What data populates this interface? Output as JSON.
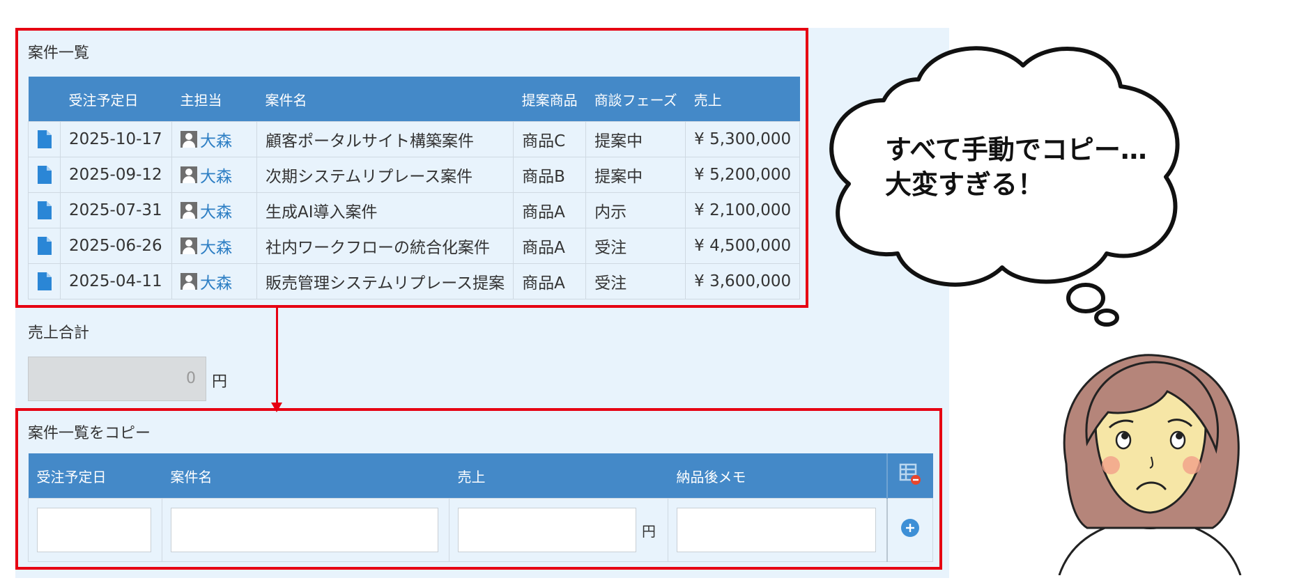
{
  "case_list": {
    "title": "案件一覧",
    "columns": [
      "",
      "受注予定日",
      "主担当",
      "案件名",
      "提案商品",
      "商談フェーズ",
      "売上"
    ],
    "rows": [
      {
        "date": "2025-10-17",
        "owner": "大森",
        "name": "顧客ポータルサイト構築案件",
        "product": "商品C",
        "phase": "提案中",
        "sales": "¥ 5,300,000"
      },
      {
        "date": "2025-09-12",
        "owner": "大森",
        "name": "次期システムリプレース案件",
        "product": "商品B",
        "phase": "提案中",
        "sales": "¥ 5,200,000"
      },
      {
        "date": "2025-07-31",
        "owner": "大森",
        "name": "生成AI導入案件",
        "product": "商品A",
        "phase": "内示",
        "sales": "¥ 2,100,000"
      },
      {
        "date": "2025-06-26",
        "owner": "大森",
        "name": "社内ワークフローの統合化案件",
        "product": "商品A",
        "phase": "受注",
        "sales": "¥ 4,500,000"
      },
      {
        "date": "2025-04-11",
        "owner": "大森",
        "name": "販売管理システムリプレース提案",
        "product": "商品A",
        "phase": "受注",
        "sales": "¥ 3,600,000"
      }
    ]
  },
  "sales_total": {
    "label": "売上合計",
    "value": "0",
    "unit": "円"
  },
  "copy_table": {
    "title": "案件一覧をコピー",
    "columns": [
      "受注予定日",
      "案件名",
      "売上",
      "納品後メモ"
    ],
    "sales_unit": "円"
  },
  "bubble": {
    "line1": "すべて手動でコピー…",
    "line2": "大変すぎる！"
  },
  "colors": {
    "header_blue": "#4489c8",
    "highlight_red": "#e60012",
    "app_bg": "#e8f3fc",
    "link_blue": "#2e7fc4"
  },
  "icons": {
    "row_record": "doc-icon",
    "owner": "person-icon",
    "remove_table": "table-remove-icon",
    "add_row": "plus-circle-icon"
  }
}
